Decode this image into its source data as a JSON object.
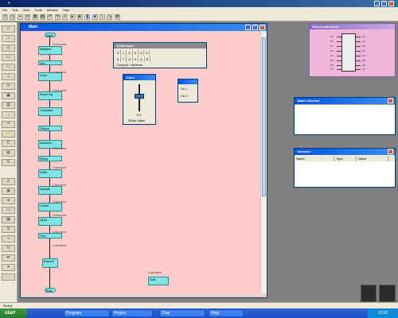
{
  "app": {
    "title": "»"
  },
  "menu": [
    "File",
    "Edit",
    "View",
    "Tools",
    "Window",
    "Help"
  ],
  "doc_window": {
    "title": "Main"
  },
  "flow_blocks": [
    {
      "text": "Start"
    },
    {
      "text": "Initialize"
    },
    {
      "text": "Var"
    },
    {
      "text": "Loop"
    },
    {
      "text": "Read Inp"
    },
    {
      "text": "Compare"
    },
    {
      "text": "Output"
    },
    {
      "text": "Decision"
    },
    {
      "text": "Delay"
    },
    {
      "text": "Write"
    },
    {
      "text": "Update"
    },
    {
      "text": "Check"
    },
    {
      "text": "Send"
    },
    {
      "text": "Port"
    },
    {
      "text": "Branch"
    },
    {
      "text": "End"
    },
    {
      "text": "Sub"
    }
  ],
  "flow_labels": [
    "Comment",
    "Comment",
    "Comment",
    "Comment",
    "Comment",
    "Comment",
    "Comment",
    "Comment",
    "Comment",
    "Comment",
    "Comment"
  ],
  "bits_panel": {
    "title": "16 Bit Input",
    "cells": [
      "0",
      "1",
      "2",
      "3",
      "4",
      "5",
      "6",
      "7",
      "8",
      "9",
      "A",
      "B"
    ],
    "footer_label": "Comport / Address"
  },
  "slider_panel": {
    "title": "Slider",
    "value_label": "0.0",
    "caption": "Slider Value"
  },
  "small_panel": {
    "items": [
      "Ch 1",
      "Ch 2"
    ]
  },
  "chip_window": {
    "title": "Chip Connections",
    "left_pins": [
      "P0",
      "P1",
      "P2",
      "P3",
      "P4",
      "P5",
      "P6",
      "P7"
    ],
    "right_pins": [
      "Q0",
      "Q1",
      "Q2",
      "Q3",
      "Q4",
      "Q5",
      "Q6",
      "Q7"
    ]
  },
  "watch_window": {
    "title": "Watch Window"
  },
  "variables_window": {
    "title": "Variables",
    "columns": [
      "Name",
      "Type",
      "Value"
    ]
  },
  "status": {
    "text": "Ready"
  },
  "taskbar": {
    "start_label": "start",
    "buttons": [
      "Program",
      "Project",
      "Chip",
      "Help"
    ],
    "clock": "12:00"
  },
  "colors": {
    "canvas": "#ffcccc",
    "block": "#7fe4e4",
    "chip_window": "#f1b5d9"
  }
}
